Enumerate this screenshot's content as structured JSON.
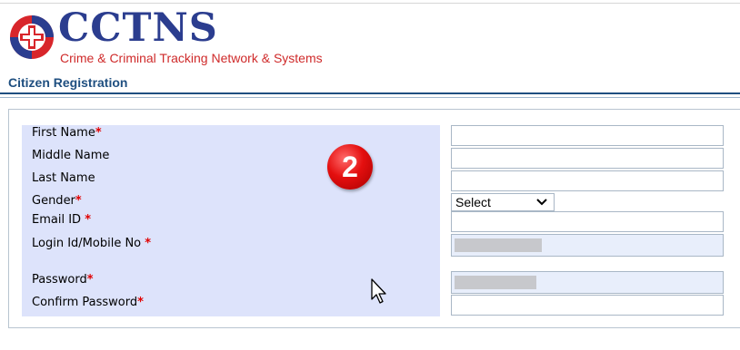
{
  "header": {
    "logo_icon": "cctns-emblem-icon",
    "brand": "CCTNS",
    "tagline": "Crime & Criminal Tracking Network & Systems"
  },
  "page": {
    "title": "Citizen Registration"
  },
  "form": {
    "required_marker": "*",
    "first_name": {
      "label": "First Name",
      "value": ""
    },
    "middle_name": {
      "label": "Middle Name",
      "value": ""
    },
    "last_name": {
      "label": "Last Name",
      "value": ""
    },
    "gender": {
      "label": "Gender",
      "selected": "Select"
    },
    "email": {
      "label": "Email ID",
      "value": ""
    },
    "login_id": {
      "label": "Login Id/Mobile No",
      "value": ""
    },
    "password": {
      "label": "Password",
      "value": ""
    },
    "confirm_password": {
      "label": "Confirm Password",
      "value": ""
    }
  },
  "overlay": {
    "step_badge": "2"
  },
  "colors": {
    "brand_blue": "#2b3d8f",
    "brand_red": "#cf2a2a",
    "label_panel": "#dde3fb",
    "required": "#e00000"
  }
}
